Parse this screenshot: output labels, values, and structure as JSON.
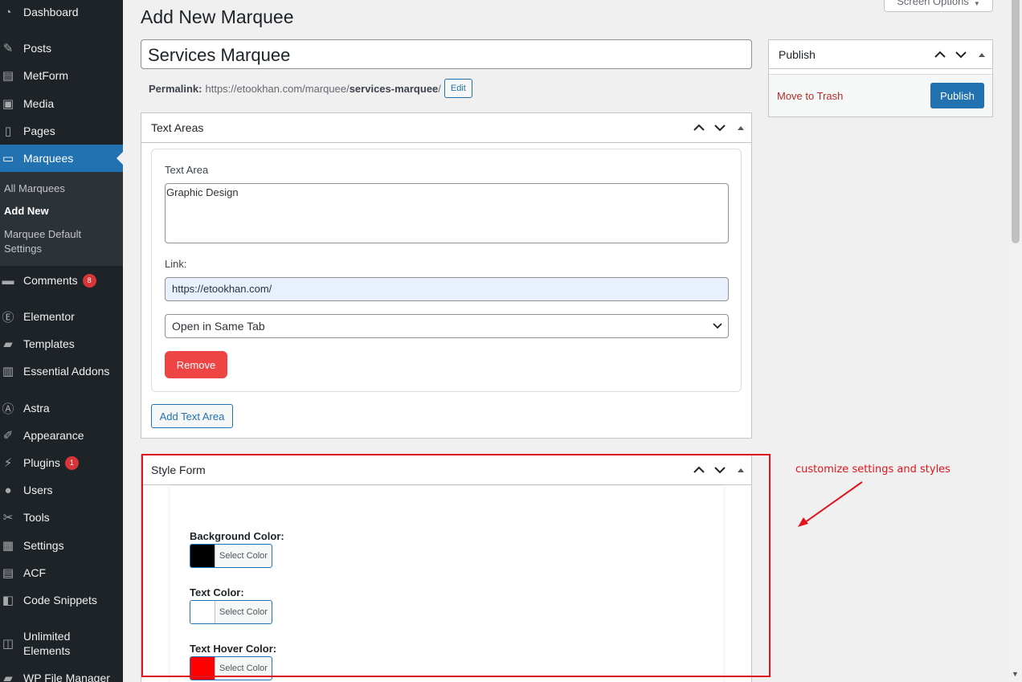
{
  "sidebar": {
    "items": [
      {
        "id": "dashboard",
        "label": "Dashboard",
        "icon": "dashboard-icon",
        "glyph": "◔"
      },
      {
        "id": "posts",
        "label": "Posts",
        "icon": "pushpin-icon",
        "glyph": "✎"
      },
      {
        "id": "metform",
        "label": "MetForm",
        "icon": "form-icon",
        "glyph": "▤"
      },
      {
        "id": "media",
        "label": "Media",
        "icon": "media-icon",
        "glyph": "▣"
      },
      {
        "id": "pages",
        "label": "Pages",
        "icon": "pages-icon",
        "glyph": "▯"
      },
      {
        "id": "marquees",
        "label": "Marquees",
        "icon": "marquee-icon",
        "glyph": "▭"
      },
      {
        "id": "comments",
        "label": "Comments",
        "icon": "comment-icon",
        "glyph": "▬",
        "badge": "8"
      },
      {
        "id": "elementor",
        "label": "Elementor",
        "icon": "elementor-icon",
        "glyph": "Ⓔ"
      },
      {
        "id": "templates",
        "label": "Templates",
        "icon": "folder-icon",
        "glyph": "▰"
      },
      {
        "id": "essential-addons",
        "label": "Essential Addons",
        "icon": "addons-icon",
        "glyph": "▥"
      },
      {
        "id": "astra",
        "label": "Astra",
        "icon": "astra-icon",
        "glyph": "Ⓐ"
      },
      {
        "id": "appearance",
        "label": "Appearance",
        "icon": "paintbrush-icon",
        "glyph": "✐"
      },
      {
        "id": "plugins",
        "label": "Plugins",
        "icon": "plugin-icon",
        "glyph": "⚡",
        "badge": "1"
      },
      {
        "id": "users",
        "label": "Users",
        "icon": "user-icon",
        "glyph": "●"
      },
      {
        "id": "tools",
        "label": "Tools",
        "icon": "wrench-icon",
        "glyph": "✂"
      },
      {
        "id": "settings",
        "label": "Settings",
        "icon": "settings-icon",
        "glyph": "▦"
      },
      {
        "id": "acf",
        "label": "ACF",
        "icon": "acf-icon",
        "glyph": "▤"
      },
      {
        "id": "code-snippets",
        "label": "Code Snippets",
        "icon": "code-icon",
        "glyph": "◧"
      },
      {
        "id": "unlimited-elements",
        "label": "Unlimited Elements",
        "icon": "elements-icon",
        "glyph": "◫"
      },
      {
        "id": "wp-file-manager",
        "label": "WP File Manager",
        "icon": "file-manager-icon",
        "glyph": "▰"
      }
    ],
    "submenu": [
      {
        "label": "All Marquees"
      },
      {
        "label": "Add New"
      },
      {
        "label": "Marquee Default Settings"
      }
    ]
  },
  "screen_options": {
    "label": "Screen Options",
    "arrow": "▼"
  },
  "page": {
    "title": "Add New Marquee"
  },
  "post": {
    "title_value": "Services Marquee",
    "permalink_label": "Permalink:",
    "permalink_base": "https://etookhan.com/marquee/",
    "permalink_slug": "services-marquee",
    "permalink_suffix": "/",
    "edit_label": "Edit"
  },
  "text_areas_box": {
    "title": "Text Areas",
    "text_area_label": "Text Area",
    "text_area_value": "Graphic Design",
    "link_label": "Link:",
    "link_value": "https://etookhan.com/",
    "target_selected": "Open in Same Tab",
    "remove_label": "Remove",
    "add_label": "Add Text Area"
  },
  "publish_box": {
    "title": "Publish",
    "trash_label": "Move to Trash",
    "publish_label": "Publish"
  },
  "style_box": {
    "title": "Style Form",
    "fields": [
      {
        "label": "Background Color:",
        "button": "Select Color",
        "color": "#000000"
      },
      {
        "label": "Text Color:",
        "button": "Select Color",
        "color": "#ffffff"
      },
      {
        "label": "Text Hover Color:",
        "button": "Select Color",
        "color": "#ff0000"
      }
    ]
  },
  "annotation": {
    "text": "customize settings and styles",
    "color": "#e1141c"
  },
  "colors": {
    "admin_bar": "#1d2327",
    "accent": "#2271b1",
    "danger": "#ef4444",
    "active_menu": "#2271b1"
  }
}
